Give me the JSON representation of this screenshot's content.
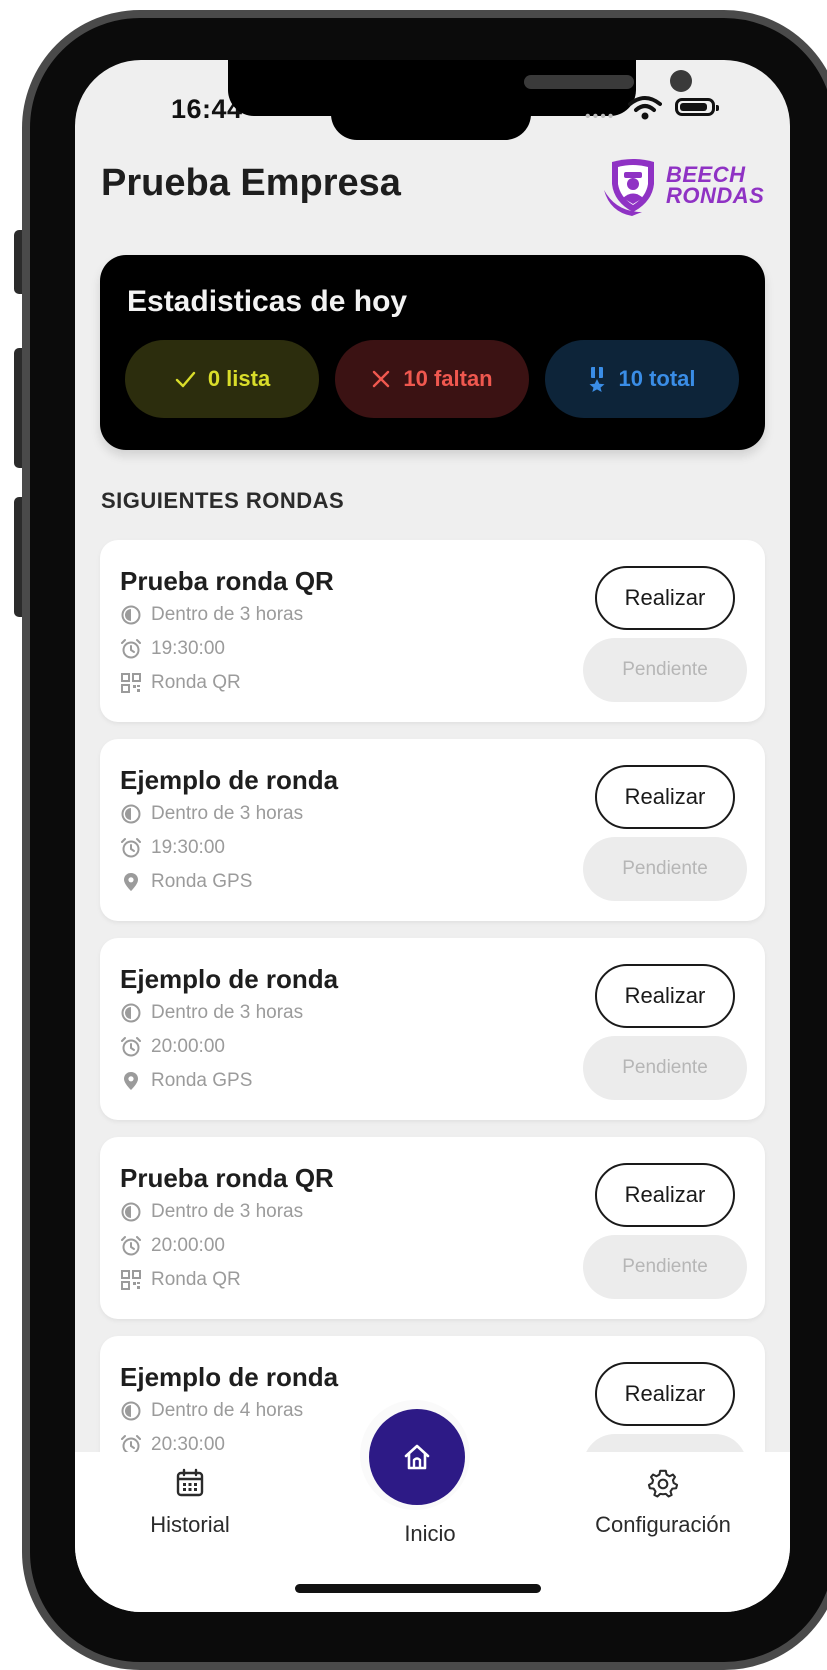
{
  "status_bar": {
    "time": "16:44"
  },
  "header": {
    "company": "Prueba Empresa",
    "logo_line1": "BEECH",
    "logo_line2": "RONDAS"
  },
  "stats": {
    "title": "Estadisticas de hoy",
    "done_label": "0 lista",
    "missing_label": "10 faltan",
    "total_label": "10 total",
    "colors": {
      "done": "#d9dd2a",
      "missing": "#f0584f",
      "total": "#3a8de6"
    }
  },
  "section_title": "SIGUIENTES RONDAS",
  "rounds": [
    {
      "title": "Prueba ronda QR",
      "eta": "Dentro de 3 horas",
      "time": "19:30:00",
      "type": "Ronda QR",
      "type_icon": "qr-icon",
      "action": "Realizar",
      "status": "Pendiente"
    },
    {
      "title": "Ejemplo de ronda",
      "eta": "Dentro de 3 horas",
      "time": "19:30:00",
      "type": "Ronda GPS",
      "type_icon": "location-pin-icon",
      "action": "Realizar",
      "status": "Pendiente"
    },
    {
      "title": "Ejemplo de ronda",
      "eta": "Dentro de 3 horas",
      "time": "20:00:00",
      "type": "Ronda GPS",
      "type_icon": "location-pin-icon",
      "action": "Realizar",
      "status": "Pendiente"
    },
    {
      "title": "Prueba ronda QR",
      "eta": "Dentro de 3 horas",
      "time": "20:00:00",
      "type": "Ronda QR",
      "type_icon": "qr-icon",
      "action": "Realizar",
      "status": "Pendiente"
    },
    {
      "title": "Ejemplo de ronda",
      "eta": "Dentro de 4 horas",
      "time": "20:30:00",
      "type": "",
      "type_icon": "",
      "action": "Realizar",
      "status": ""
    }
  ],
  "nav": {
    "history": "Historial",
    "home": "Inicio",
    "settings": "Configuración"
  },
  "brand_colors": {
    "logo": "#8f32c4",
    "home_button": "#2d1a86"
  }
}
